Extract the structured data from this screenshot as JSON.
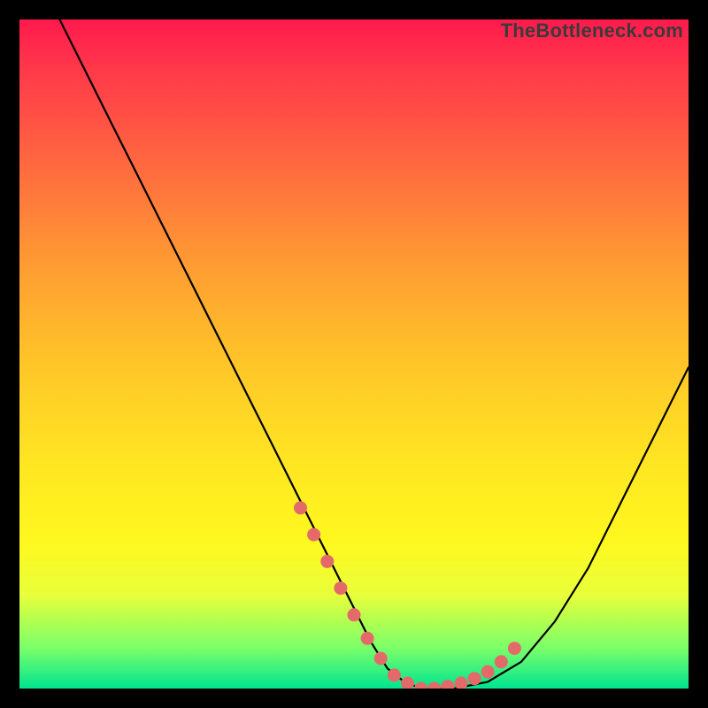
{
  "watermark": "TheBottleneck.com",
  "chart_data": {
    "type": "line",
    "title": "",
    "xlabel": "",
    "ylabel": "",
    "xlim": [
      0,
      100
    ],
    "ylim": [
      0,
      100
    ],
    "series": [
      {
        "name": "bottleneck-curve",
        "x": [
          6,
          10,
          14,
          18,
          22,
          26,
          30,
          34,
          38,
          42,
          46,
          50,
          52.5,
          55,
          57.5,
          60,
          65,
          70,
          75,
          80,
          85,
          90,
          95,
          100
        ],
        "values": [
          100,
          92,
          84,
          76,
          68,
          60,
          52,
          44,
          36,
          28,
          20,
          12,
          7,
          3,
          1,
          0,
          0,
          1,
          4,
          10,
          18,
          28,
          38,
          48
        ]
      }
    ],
    "markers": {
      "name": "highlight-dots",
      "color": "#e46a6a",
      "x": [
        42,
        44,
        46,
        48,
        50,
        52,
        54,
        56,
        58,
        60,
        62,
        64,
        66,
        68,
        70,
        72,
        74
      ],
      "values": [
        27,
        23,
        19,
        15,
        11,
        7.5,
        4.5,
        2,
        0.8,
        0,
        0,
        0.3,
        0.8,
        1.5,
        2.5,
        4,
        6
      ]
    }
  }
}
